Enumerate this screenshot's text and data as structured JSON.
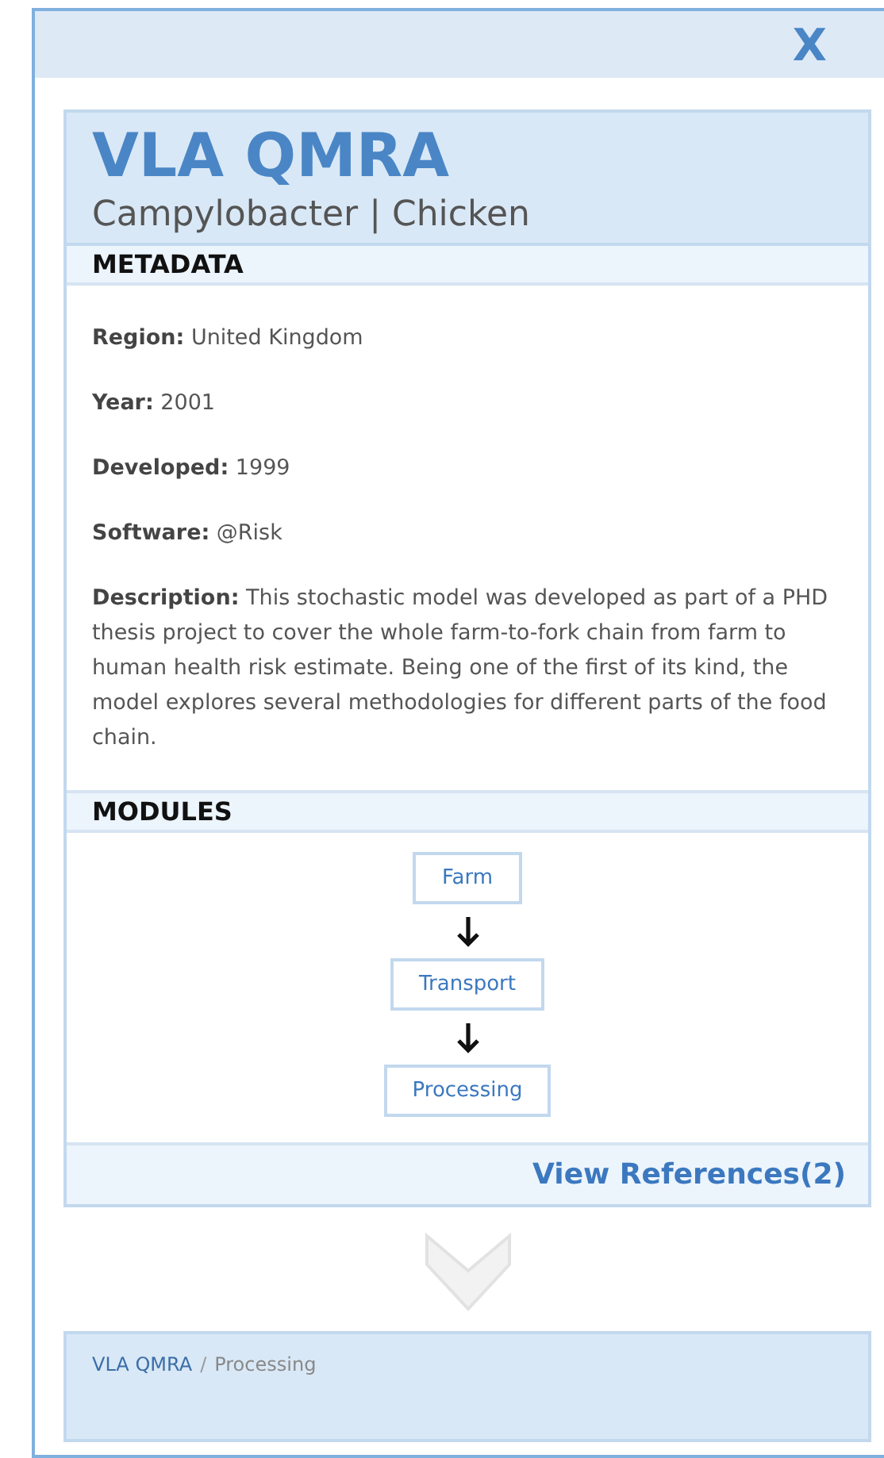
{
  "dialog": {
    "close_label": "X"
  },
  "model": {
    "title": "VLA QMRA",
    "subtitle": "Campylobacter | Chicken"
  },
  "metadata": {
    "heading": "METADATA",
    "fields": [
      {
        "label": "Region:",
        "value": "United Kingdom"
      },
      {
        "label": "Year:",
        "value": "2001"
      },
      {
        "label": "Developed:",
        "value": "1999"
      },
      {
        "label": "Software:",
        "value": "@Risk"
      },
      {
        "label": "Description:",
        "value": "This stochastic model was developed as part of a PHD thesis project to cover the whole farm-to-fork chain from farm to human health risk estimate. Being one of the first of its kind, the model explores several methodologies for different parts of the food chain."
      }
    ]
  },
  "modules": {
    "heading": "MODULES",
    "items": [
      "Farm",
      "Transport",
      "Processing"
    ]
  },
  "references_link": "View References(2)",
  "next_card": {
    "breadcrumb": [
      {
        "label": "VLA QMRA",
        "kind": "link"
      },
      {
        "label": "Processing",
        "kind": "current"
      }
    ],
    "separator": "/"
  }
}
